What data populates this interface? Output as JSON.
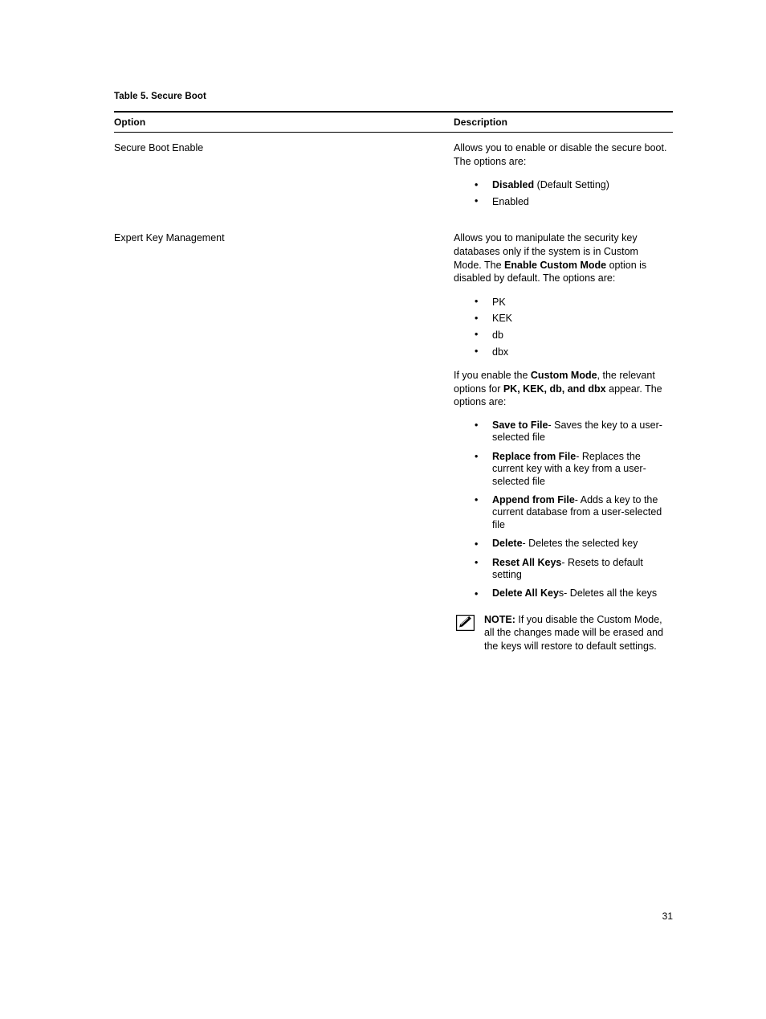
{
  "page": {
    "number": "31",
    "background": "#ffffff",
    "text_color": "#000000"
  },
  "table": {
    "caption": "Table 5. Secure Boot",
    "columns": [
      {
        "key": "option",
        "header": "Option"
      },
      {
        "key": "description",
        "header": "Description"
      }
    ],
    "rows": [
      {
        "option": "Secure Boot Enable",
        "description": {
          "intro": "Allows you to enable or disable the secure boot. The options are:",
          "bullets": [
            {
              "bold": "Disabled",
              "rest": " (Default Setting)"
            },
            {
              "bold": "",
              "rest": "Enabled"
            }
          ]
        }
      },
      {
        "option": "Expert Key Management",
        "description": {
          "intro_part1": "Allows you to manipulate the security key databases only if the system is in Custom Mode. The ",
          "intro_bold": "Enable Custom Mode",
          "intro_part2": " option is disabled by default. The options are:",
          "key_bullets": [
            "PK",
            "KEK",
            "db",
            "dbx"
          ],
          "custom_part1": "If you enable the ",
          "custom_bold1": "Custom Mode",
          "custom_part2": ", the relevant options for ",
          "custom_bold2": "PK, KEK, db, and dbx",
          "custom_part3": " appear. The options are:",
          "option_bullets": [
            {
              "bold": "Save to File",
              "rest": "- Saves the key to a user-selected file"
            },
            {
              "bold": "Replace from File",
              "rest": "- Replaces the current key with a key from a user-selected file"
            },
            {
              "bold": "Append from File",
              "rest": "- Adds a key to the current database from a user-selected file"
            },
            {
              "bold": "Delete",
              "rest": "- Deletes the selected key"
            },
            {
              "bold": "Reset All Keys",
              "rest": "- Resets to default setting"
            },
            {
              "bold": "Delete All Key",
              "rest": "s- Deletes all the keys"
            }
          ],
          "note": {
            "icon": "note-pencil-icon",
            "label": "NOTE:",
            "text": " If you disable the Custom Mode, all the changes made will be erased and the keys will restore to default settings."
          }
        }
      }
    ]
  }
}
